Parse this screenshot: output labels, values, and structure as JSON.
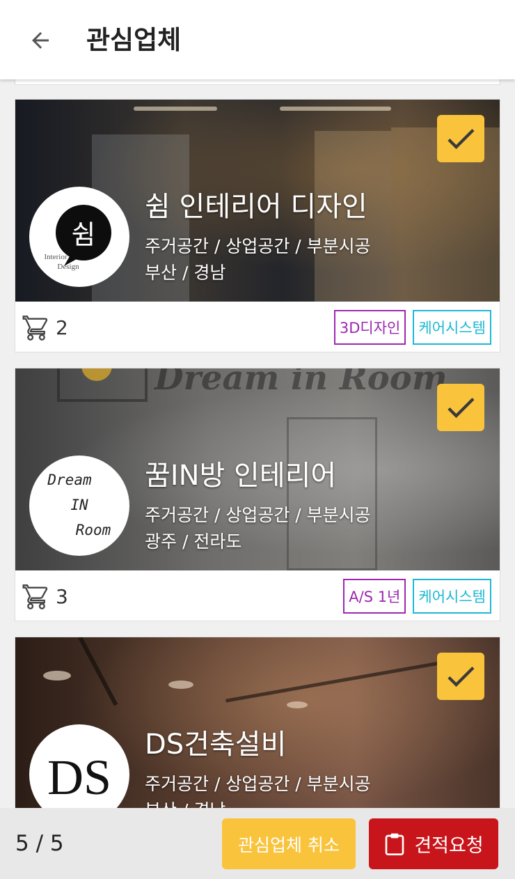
{
  "header": {
    "title": "관심업체",
    "back_icon": "arrow-left-icon"
  },
  "colors": {
    "accent_yellow": "#f9c33b",
    "quote_red": "#c8151b",
    "tag_purple": "#9c27b0",
    "tag_cyan": "#1bb8d4"
  },
  "companies": [
    {
      "name": "쉼 인테리어 디자인",
      "services": "주거공간 / 상업공간 / 부분시공",
      "region": "부산 / 경남",
      "cart_count": "2",
      "logo": {
        "main": "쉼",
        "line1": "Interior",
        "line2": "Design"
      },
      "checked": true,
      "tags": [
        "3D디자인",
        "케어시스템"
      ]
    },
    {
      "name": "꿈IN방 인테리어",
      "services": "주거공간 / 상업공간 / 부분시공",
      "region": "광주 / 전라도",
      "cart_count": "3",
      "logo": {
        "line1": "Dream",
        "line2": "IN",
        "line3": "Room"
      },
      "wall_text": "Dream in Room",
      "checked": true,
      "tags": [
        "A/S 1년",
        "케어시스템"
      ]
    },
    {
      "name": "DS건축설비",
      "services": "주거공간 / 상업공간 / 부분시공",
      "region": "부산 / 경남",
      "logo": {
        "main": "DS"
      },
      "checked": true
    }
  ],
  "footer": {
    "page_indicator": "5 / 5",
    "cancel_label": "관심업체 취소",
    "quote_label": "견적요청",
    "quote_icon": "clipboard-icon"
  }
}
